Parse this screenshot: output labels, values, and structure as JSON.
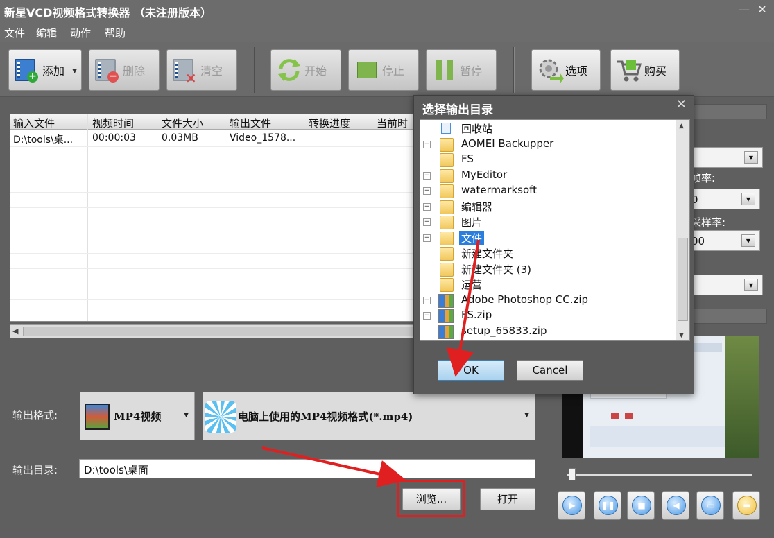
{
  "window": {
    "title": "新星VCD视频格式转换器 （未注册版本）",
    "minimize": "—",
    "close": "✕"
  },
  "menu": [
    "文件",
    "编辑",
    "动作",
    "帮助"
  ],
  "toolbar": {
    "add": "添加",
    "delete": "删除",
    "clear": "清空",
    "start": "开始",
    "stop": "停止",
    "pause": "暂停",
    "options": "选项",
    "buy": "购买"
  },
  "file_list": {
    "columns": [
      "输入文件",
      "视频时间",
      "文件大小",
      "输出文件",
      "转换进度",
      "当前时"
    ],
    "rows": [
      {
        "input": "D:\\tools\\桌...",
        "duration": "00:00:03",
        "size": "0.03MB",
        "output": "Video_1578..."
      }
    ]
  },
  "output": {
    "format_label": "输出格式:",
    "format_value": "MP4视频",
    "format_desc": "电脑上使用的MP4视频格式(*.mp4)",
    "dir_label": "输出目录:",
    "dir_value": "D:\\tools\\桌面",
    "browse": "浏览...",
    "open": "打开"
  },
  "right_panel": {
    "label_frame_rate": "帧率:",
    "label_sample_rate": "采样率:",
    "frame_rate_value": "0",
    "sample_rate_value": "00"
  },
  "dialog": {
    "title": "选择输出目录",
    "close": "✕",
    "items": [
      {
        "label": "回收站",
        "kind": "bin",
        "expander": false
      },
      {
        "label": "AOMEI Backupper",
        "kind": "folder",
        "expander": true
      },
      {
        "label": "FS",
        "kind": "folder",
        "expander": false
      },
      {
        "label": "MyEditor",
        "kind": "folder",
        "expander": true
      },
      {
        "label": "watermarksoft",
        "kind": "folder",
        "expander": true
      },
      {
        "label": "编辑器",
        "kind": "folder",
        "expander": true
      },
      {
        "label": "图片",
        "kind": "folder",
        "expander": true
      },
      {
        "label": "文件",
        "kind": "folder",
        "expander": true,
        "selected": true
      },
      {
        "label": "新建文件夹",
        "kind": "folder",
        "expander": false
      },
      {
        "label": "新建文件夹 (3)",
        "kind": "folder",
        "expander": false
      },
      {
        "label": "运营",
        "kind": "folder",
        "expander": false
      },
      {
        "label": "Adobe Photoshop CC.zip",
        "kind": "zip",
        "expander": true
      },
      {
        "label": "FS.zip",
        "kind": "zip",
        "expander": true
      },
      {
        "label": "setup_65833.zip",
        "kind": "zip",
        "expander": false
      }
    ],
    "ok": "OK",
    "cancel": "Cancel"
  },
  "colors": {
    "annotation": "#e02020",
    "selection": "#2a7fde",
    "dialog_ok": "#b9dcf5"
  },
  "icons": {
    "add": "film-add-icon",
    "delete": "film-delete-icon",
    "clear": "film-clear-icon",
    "start": "refresh-arrows-icon",
    "stop": "stop-icon",
    "pause": "pause-icon",
    "options": "gear-icon",
    "buy": "shopping-cart-icon",
    "player": [
      "play-icon",
      "pause-icon",
      "stop-icon",
      "volume-icon",
      "snapshot-icon",
      "folder-icon"
    ]
  }
}
